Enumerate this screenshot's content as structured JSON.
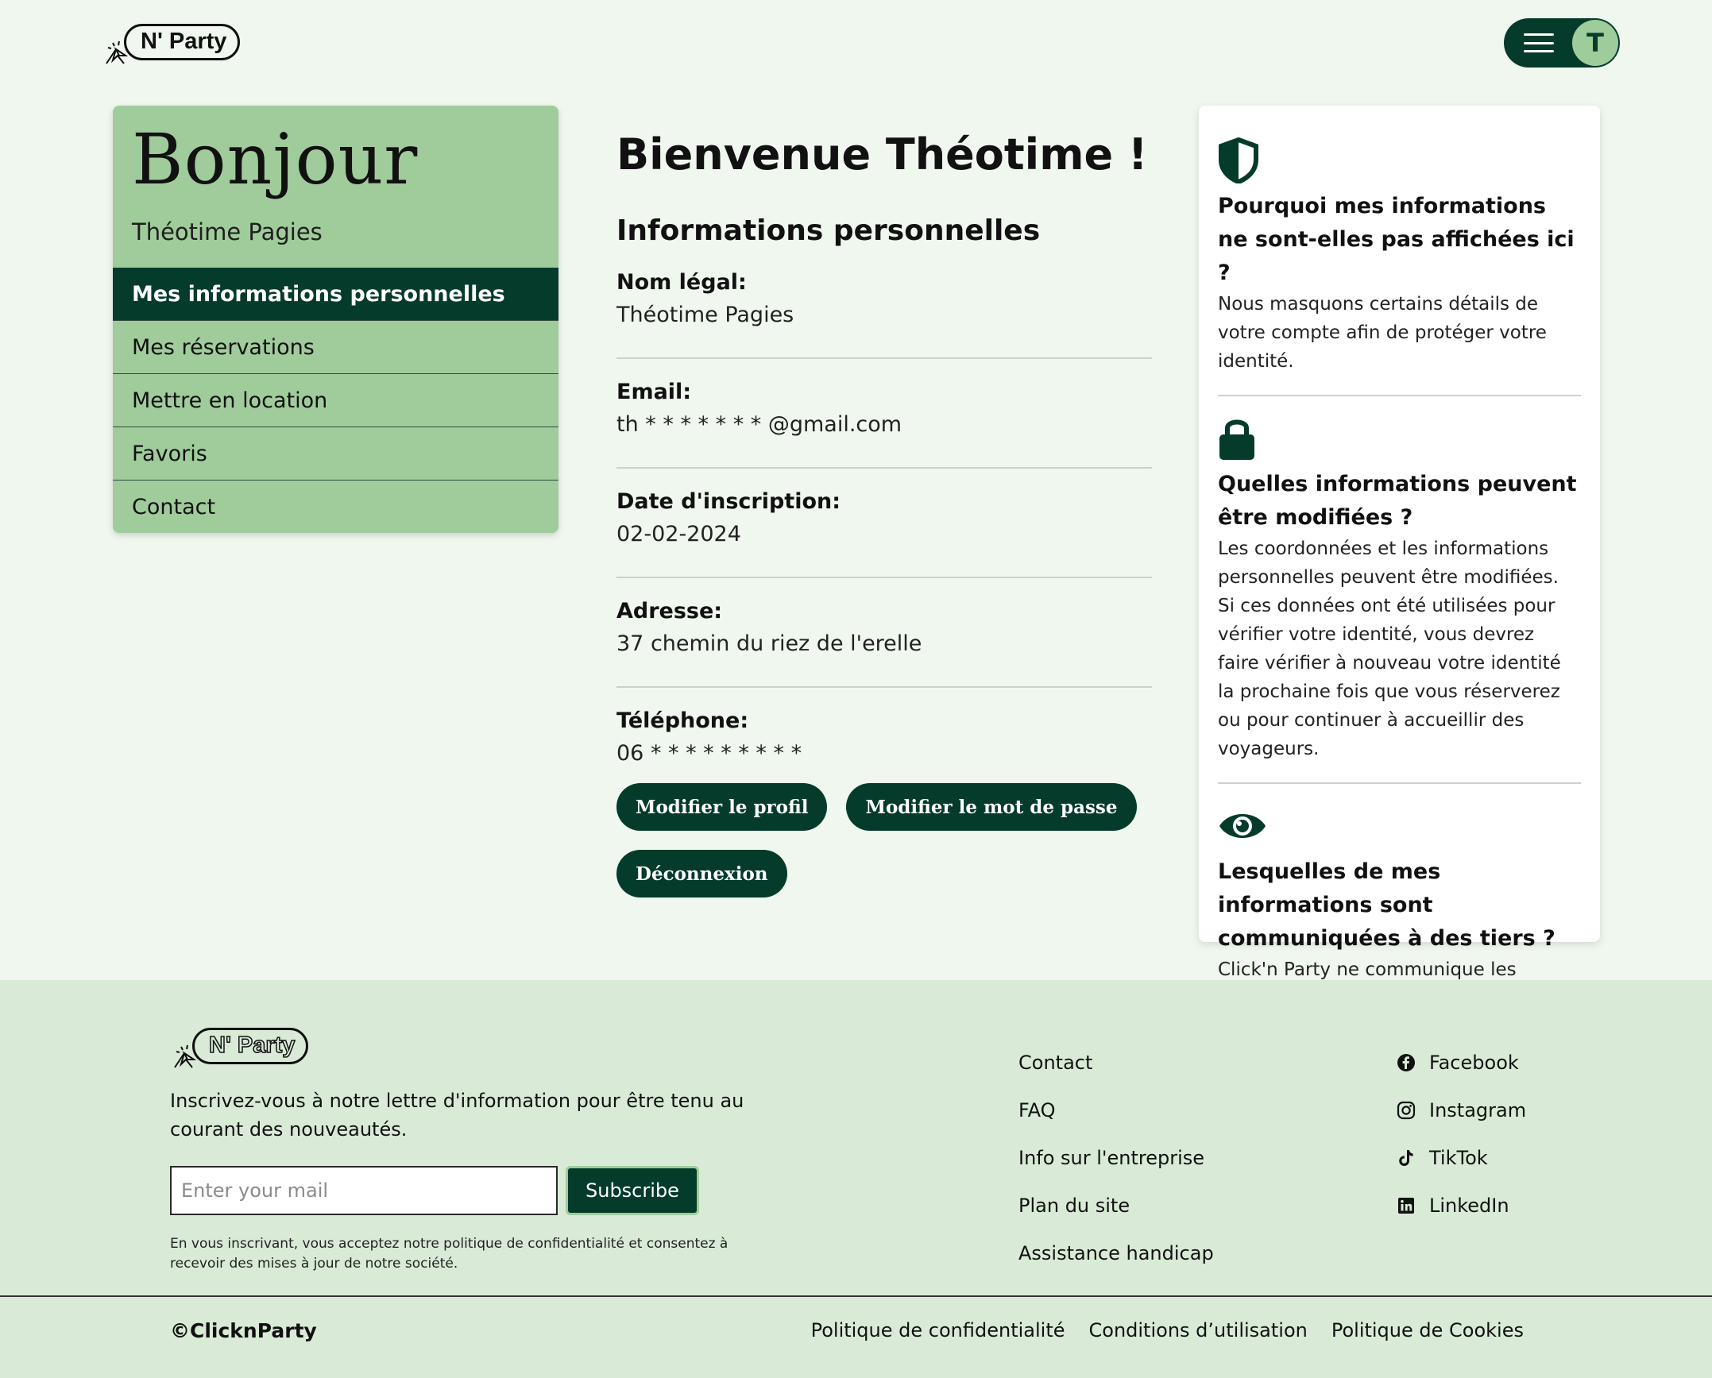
{
  "brand": {
    "logo_text": "N' Party",
    "accent_color": "#053b2b",
    "light_green": "#a0cc9b"
  },
  "header": {
    "menu_icon": "hamburger-icon",
    "avatar_initial": "T"
  },
  "sidebar": {
    "greeting": "Bonjour",
    "user_name": "Théotime Pagies",
    "items": [
      {
        "label": "Mes informations personnelles",
        "active": true
      },
      {
        "label": "Mes réservations"
      },
      {
        "label": "Mettre en location"
      },
      {
        "label": "Favoris"
      },
      {
        "label": "Contact"
      }
    ]
  },
  "main": {
    "title": "Bienvenue Théotime !",
    "section_title": "Informations personnelles",
    "fields": [
      {
        "label": "Nom légal:",
        "value": "Théotime Pagies"
      },
      {
        "label": "Email:",
        "value": "th * * * * * * * @gmail.com"
      },
      {
        "label": "Date d'inscription:",
        "value": "02-02-2024"
      },
      {
        "label": "Adresse:",
        "value": "37 chemin du riez de l'erelle"
      },
      {
        "label": "Téléphone:",
        "value": "06 * * * * * * * * *"
      }
    ],
    "buttons": {
      "edit_profile": "Modifier le profil",
      "edit_password": "Modifier le mot de passe",
      "logout": "Déconnexion"
    }
  },
  "info_card": {
    "sections": [
      {
        "icon": "shield-icon",
        "title": "Pourquoi mes informations ne sont-elles pas affichées ici ?",
        "text": "Nous masquons certains détails de votre compte afin de protéger votre identité."
      },
      {
        "icon": "lock-icon",
        "title": "Quelles informations peuvent être modifiées ?",
        "text": "Les coordonnées et les informations personnelles peuvent être modifiées. Si ces données ont été utilisées pour vérifier votre identité, vous devrez faire vérifier à nouveau votre identité la prochaine fois que vous réserverez ou pour continuer à accueillir des voyageurs."
      },
      {
        "icon": "eye-icon",
        "title": "Lesquelles de mes informations sont communiquées à des tiers ?",
        "text": "Click'n Party ne communique les coordonnées aux hôtes et aux voyageurs qu'après la confirmation d'une réservation."
      }
    ]
  },
  "footer": {
    "newsletter_text": "Inscrivez-vous à notre lettre d'information pour être tenu au courant des nouveautés.",
    "mail_placeholder": "Enter your mail",
    "subscribe_label": "Subscribe",
    "disclaimer": "En vous inscrivant, vous acceptez notre politique de confidentialité et consentez à recevoir des mises à jour de notre société.",
    "links": [
      "Contact",
      "FAQ",
      "Info sur l'entreprise",
      "Plan du site",
      "Assistance handicap"
    ],
    "social": [
      {
        "label": "Facebook",
        "icon": "facebook-icon"
      },
      {
        "label": "Instagram",
        "icon": "instagram-icon"
      },
      {
        "label": "TikTok",
        "icon": "tiktok-icon"
      },
      {
        "label": "LinkedIn",
        "icon": "linkedin-icon"
      }
    ],
    "copyright": "©ClicknParty",
    "legal": [
      "Politique de confidentialité",
      "Conditions d’utilisation",
      "Politique de Cookies"
    ]
  }
}
